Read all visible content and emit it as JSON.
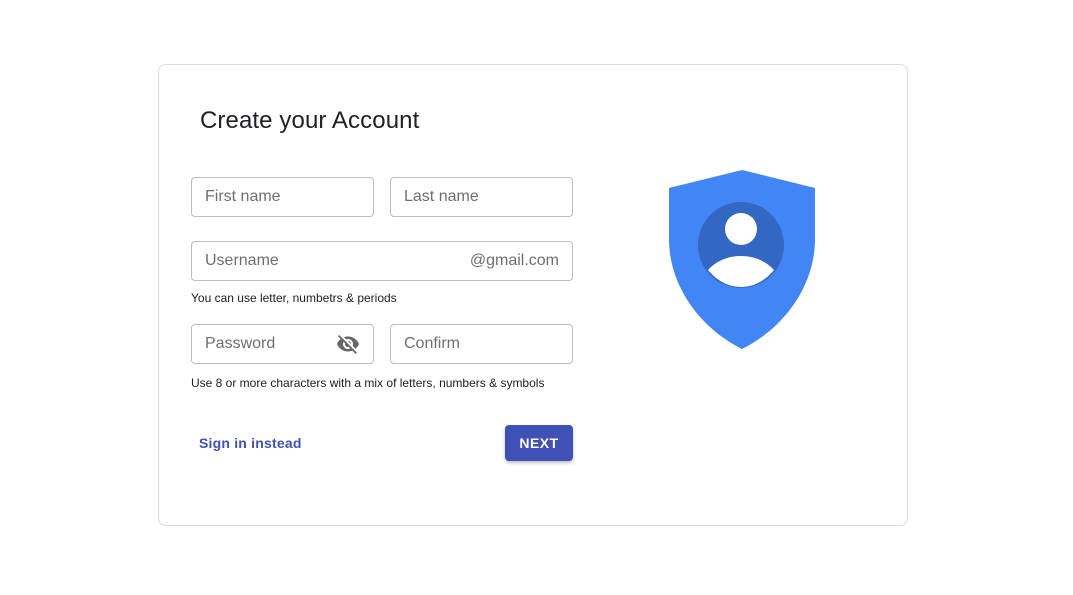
{
  "form": {
    "title": "Create your Account",
    "first_name_placeholder": "First name",
    "last_name_placeholder": "Last name",
    "username_placeholder": "Username",
    "username_suffix": "@gmail.com",
    "username_hint": "You can use letter, numbetrs & periods",
    "password_placeholder": "Password",
    "confirm_placeholder": "Confirm",
    "password_hint": "Use 8 or more characters with a mix of letters, numbers & symbols",
    "sign_in_label": "Sign in instead",
    "next_label": "NEXT"
  },
  "icons": {
    "password_toggle": "visibility-off-icon",
    "illustration": "account-shield-icon"
  },
  "colors": {
    "accent": "#3f51b5",
    "shield_light": "#4285f4",
    "shield_dark": "#3367c4",
    "border": "#dadce0"
  }
}
